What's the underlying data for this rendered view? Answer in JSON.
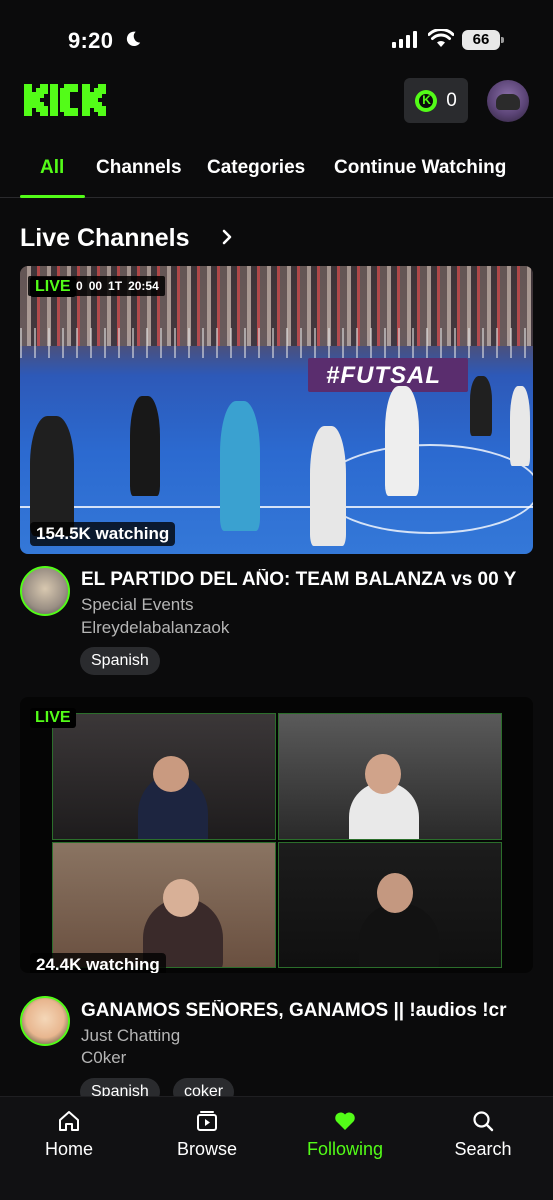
{
  "status_bar": {
    "time": "9:20",
    "battery": "66"
  },
  "header": {
    "coin_count": "0",
    "accent_color": "#53fc18"
  },
  "tabs": [
    {
      "label": "All",
      "active": true
    },
    {
      "label": "Channels"
    },
    {
      "label": "Categories"
    },
    {
      "label": "Continue Watching"
    }
  ],
  "section": {
    "title": "Live Channels"
  },
  "streams": [
    {
      "live_label": "LIVE",
      "scorebug": [
        "0",
        "00",
        "1T",
        "20:54"
      ],
      "banner_text": "#FUTSAL",
      "viewers": "154.5K watching",
      "title": "EL PARTIDO DEL AÑO: TEAM BALANZA vs 00 Y",
      "category": "Special Events",
      "channel": "Elreydelabalanzaok",
      "tags": [
        "Spanish"
      ]
    },
    {
      "live_label": "LIVE",
      "viewers": "24.4K watching",
      "title": "GANAMOS SEÑORES, GANAMOS || !audios !cr",
      "category": "Just Chatting",
      "channel": "C0ker",
      "tags": [
        "Spanish",
        "coker"
      ]
    }
  ],
  "nav": [
    {
      "label": "Home",
      "icon": "home-icon"
    },
    {
      "label": "Browse",
      "icon": "browse-icon"
    },
    {
      "label": "Following",
      "icon": "heart-icon",
      "active": true
    },
    {
      "label": "Search",
      "icon": "search-icon"
    }
  ]
}
